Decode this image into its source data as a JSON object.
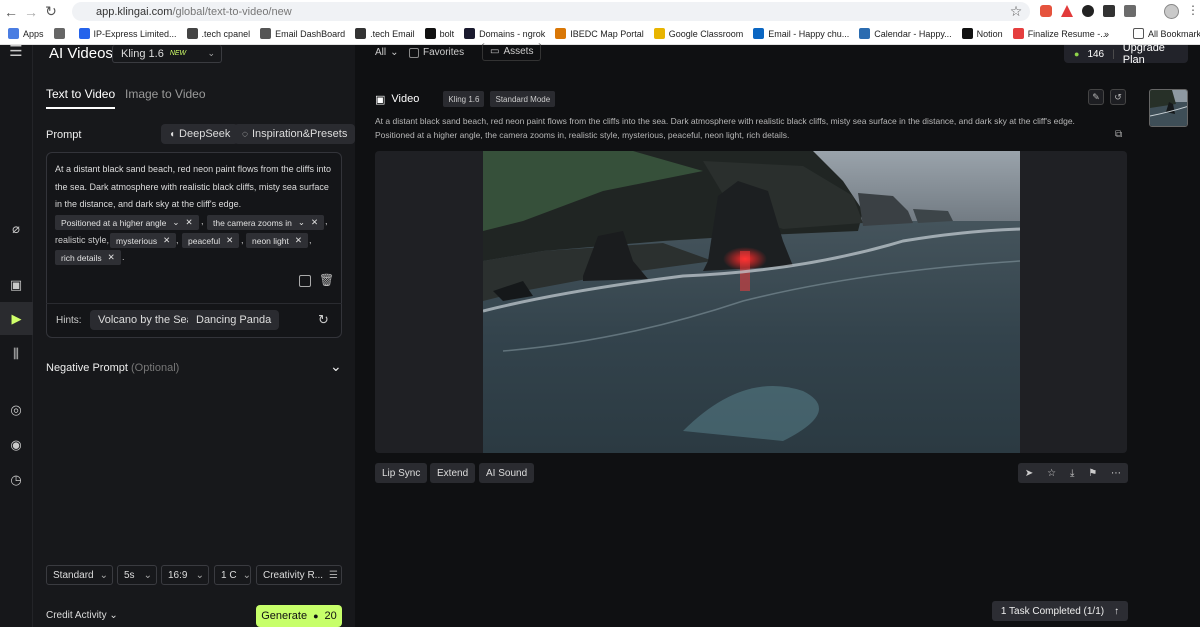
{
  "browser": {
    "url_host": "app.klingai.com",
    "url_path": "/global/text-to-video/new",
    "bookmarks": [
      {
        "label": "Apps",
        "color": "#4a7de2"
      },
      {
        "label": "",
        "color": "#666"
      },
      {
        "label": "IP-Express Limited...",
        "color": "#2563eb"
      },
      {
        "label": ".tech cpanel",
        "color": "#444"
      },
      {
        "label": "Email DashBoard",
        "color": "#555"
      },
      {
        "label": ".tech Email",
        "color": "#333"
      },
      {
        "label": "bolt",
        "color": "#111"
      },
      {
        "label": "Domains - ngrok",
        "color": "#1a1a2e"
      },
      {
        "label": "IBEDC Map Portal",
        "color": "#d97706"
      },
      {
        "label": "Google Classroom",
        "color": "#e8b400"
      },
      {
        "label": "Email - Happy chu...",
        "color": "#0a66c2"
      },
      {
        "label": "Calendar - Happy...",
        "color": "#2b6cb0"
      },
      {
        "label": "Notion",
        "color": "#111"
      },
      {
        "label": "Finalize Resume -...",
        "color": "#e53e3e"
      }
    ],
    "all_bookmarks": "All Bookmarks"
  },
  "left": {
    "title": "AI Videos",
    "model": "Kling 1.6",
    "model_badge": "NEW",
    "tabs": [
      "Text to Video",
      "Image to Video"
    ],
    "prompt_label": "Prompt",
    "deepseek": "DeepSeek",
    "inspiration": "Inspiration&Presets",
    "prompt_text": "At a distant black sand beach, red neon paint flows from the cliffs into the sea. Dark atmosphere with realistic black cliffs, misty sea surface in the distance, and dark sky at the cliff's edge.",
    "chips": [
      "Positioned at a higher angle",
      "the camera zooms in",
      "mysterious",
      "peaceful",
      "neon light",
      "rich details"
    ],
    "plain_realistic": "realistic style,",
    "hints_label": "Hints:",
    "hints": [
      "Volcano by the Sea",
      "Dancing Panda"
    ],
    "negative_label": "Negative Prompt",
    "negative_optional": "(Optional)",
    "settings": [
      "Standard",
      "5s",
      "16:9",
      "1 C",
      "Creativity R..."
    ],
    "credit_activity": "Credit Activity",
    "generate": "Generate",
    "generate_cost": "20"
  },
  "main": {
    "filter_all": "All",
    "favorites": "Favorites",
    "assets": "Assets",
    "credits": "146",
    "upgrade": "Upgrade Plan",
    "video_title": "Video",
    "tags": [
      "Kling 1.6",
      "Standard Mode"
    ],
    "description": "At a distant black sand beach, red neon paint flows from the cliffs into the sea. Dark atmosphere with realistic black cliffs, misty sea surface in the distance, and dark sky at the cliff's edge. Positioned at a higher angle, the camera zooms in, realistic style, mysterious, peaceful, neon light, rich details.",
    "actions": [
      "Lip Sync",
      "Extend",
      "AI Sound"
    ],
    "task_status": "1 Task Completed",
    "task_count": "(1/1)"
  }
}
